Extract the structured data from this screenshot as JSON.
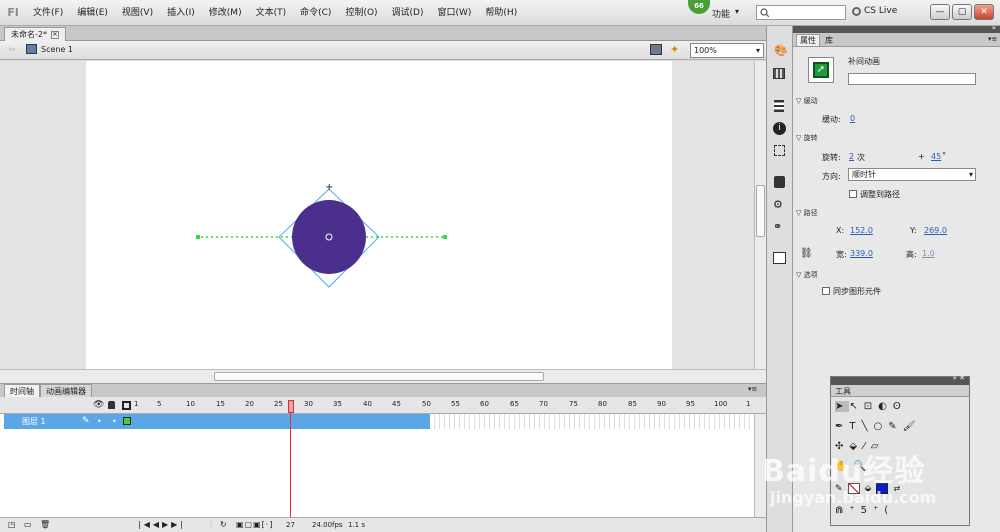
{
  "menu": {
    "items": [
      "文件(F)",
      "编辑(E)",
      "视图(V)",
      "插入(I)",
      "修改(M)",
      "文本(T)",
      "命令(C)",
      "控制(O)",
      "调试(D)",
      "窗口(W)",
      "帮助(H)"
    ],
    "workspace_badge": "66",
    "workspace_label": "功能",
    "cs_live": "CS Live"
  },
  "document": {
    "tab_label": "未命名-2*",
    "scene_label": "Scene 1",
    "zoom": "100%"
  },
  "timeline": {
    "tabs": [
      "时间轴",
      "动画编辑器"
    ],
    "ruler": [
      "1",
      "5",
      "10",
      "15",
      "20",
      "25",
      "30",
      "35",
      "40",
      "45",
      "50",
      "55",
      "60",
      "65",
      "70",
      "75",
      "80",
      "85",
      "90",
      "95",
      "100",
      "1"
    ],
    "layer_name": "图层 1",
    "current_frame": "27",
    "fps": "24.00",
    "fps_unit": "fps",
    "time": "1.1 s"
  },
  "properties": {
    "tabs": [
      "属性",
      "库"
    ],
    "title": "补间动画",
    "ease_section": "缓动",
    "ease_label": "缓动:",
    "ease_value": "0",
    "rotate_section": "旋转",
    "rotate_label": "旋转:",
    "rotate_count": "2",
    "rotate_unit": "次",
    "rotate_plus": "+",
    "rotate_deg": "45",
    "rotate_deg_unit": "°",
    "direction_label": "方向:",
    "direction_value": "顺时针",
    "orient_label": "调整到路径",
    "path_section": "路径",
    "x_label": "X:",
    "x_value": "152.0",
    "y_label": "Y:",
    "y_value": "269.0",
    "w_label": "宽:",
    "w_value": "339.0",
    "h_label": "高:",
    "h_value": "1.0",
    "options_section": "选项",
    "sync_label": "同步图形元件"
  },
  "tools": {
    "title": "工具"
  },
  "watermark": {
    "brand": "Baidu经验",
    "url": "jingyan.baidu.com"
  },
  "colors": {
    "circle": "#4a2f8c",
    "path": "#33dd33",
    "bbox": "#58a8e8",
    "layer": "#5aa6e6",
    "playhead": "#e53030"
  }
}
